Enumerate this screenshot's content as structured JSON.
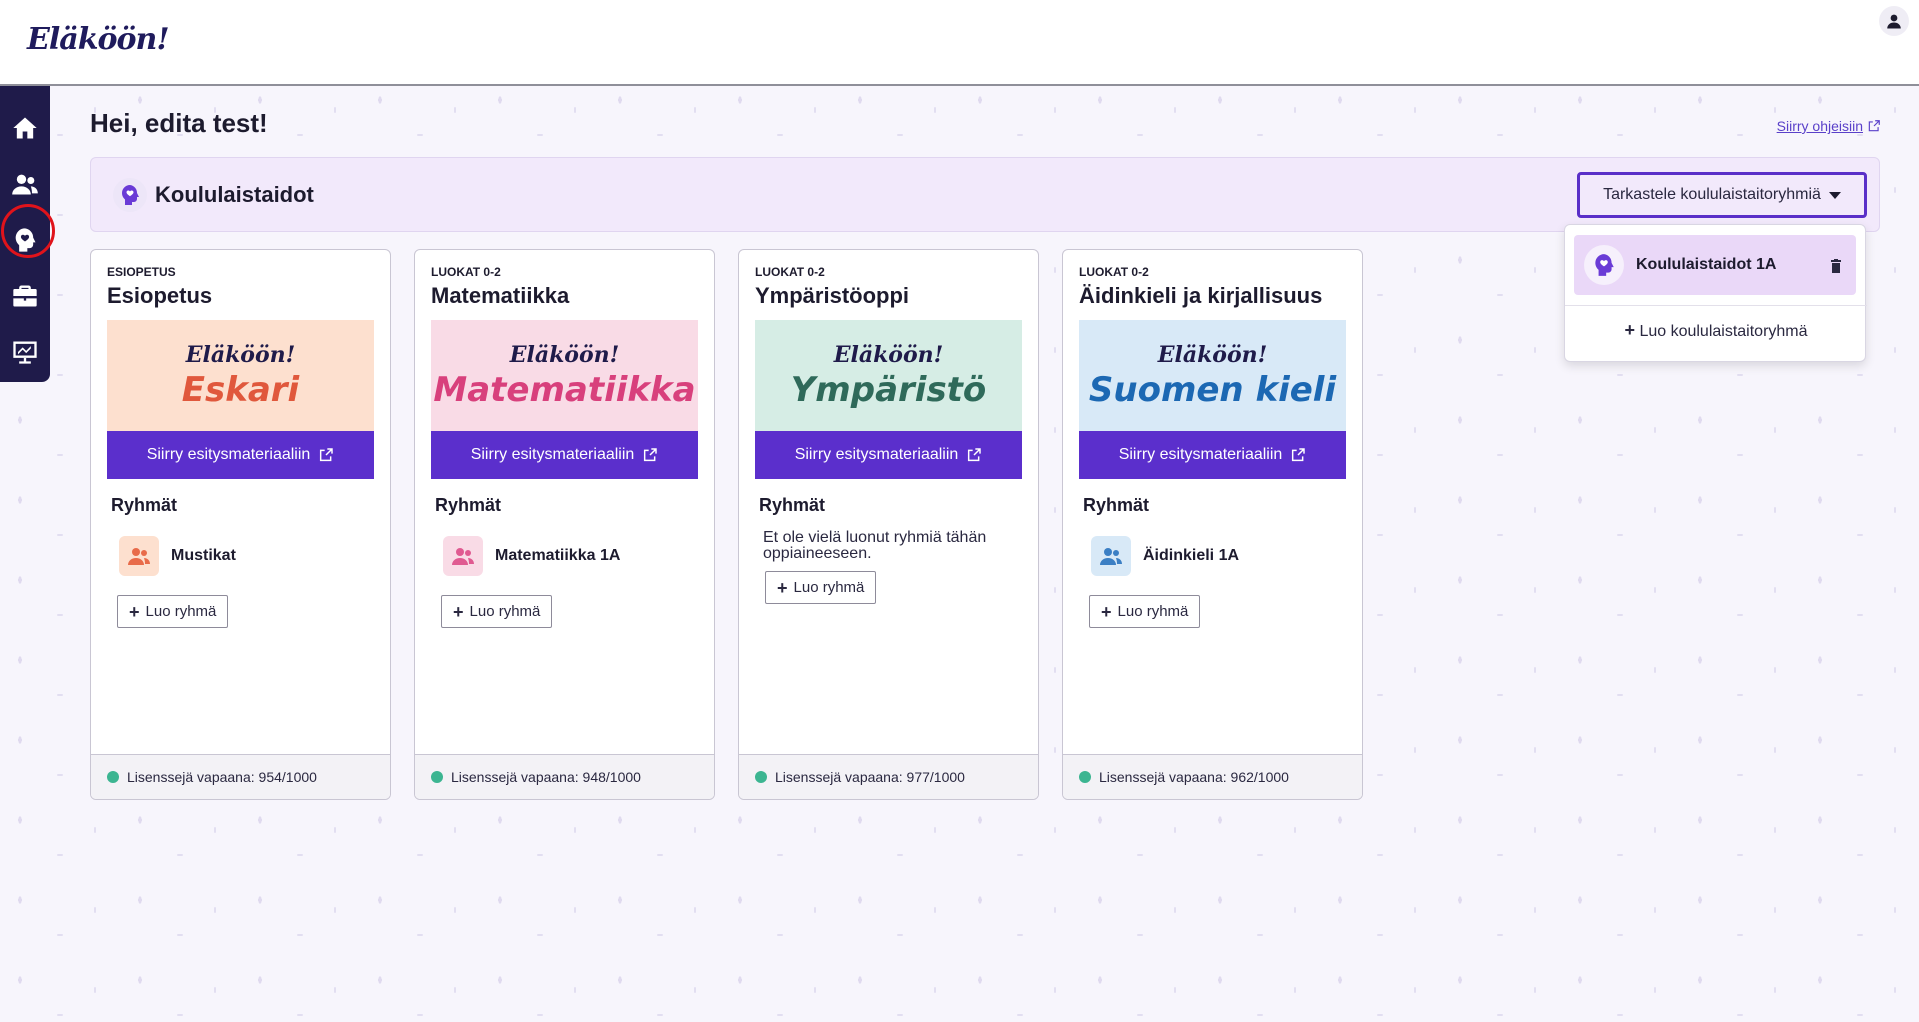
{
  "app": {
    "logo": "Eläköön!"
  },
  "header": {
    "greeting": "Hei, edita test!",
    "help_link": "Siirry ohjeisiin"
  },
  "section": {
    "title": "Koululaistaidot",
    "view_groups_button": "Tarkastele koululaistaitoryhmiä",
    "dropdown": {
      "items": [
        {
          "label": "Koululaistaidot 1A"
        }
      ],
      "create_label": "Luo koululaistaitoryhmä"
    }
  },
  "cards": [
    {
      "eyebrow": "ESIOPETUS",
      "title": "Esiopetus",
      "banner_brand": "Eläköön!",
      "banner_name": "Eskari",
      "cta": "Siirry esitysmateriaaliin",
      "groups_heading": "Ryhmät",
      "groups": [
        {
          "name": "Mustikat"
        }
      ],
      "empty_text": "",
      "create_group": "Luo ryhmä",
      "license": "Lisenssejä vapaana: 954/1000",
      "colors": {
        "banner_bg": "#fde0cf",
        "banner_text": "#e0583c",
        "avatar_bg": "#fde0cf",
        "avatar_icon": "#e86b4a"
      }
    },
    {
      "eyebrow": "LUOKAT 0-2",
      "title": "Matematiikka",
      "banner_brand": "Eläköön!",
      "banner_name": "Matematiikka",
      "cta": "Siirry esitysmateriaaliin",
      "groups_heading": "Ryhmät",
      "groups": [
        {
          "name": "Matematiikka 1A"
        }
      ],
      "empty_text": "",
      "create_group": "Luo ryhmä",
      "license": "Lisenssejä vapaana: 948/1000",
      "colors": {
        "banner_bg": "#f9dbe6",
        "banner_text": "#d8407c",
        "avatar_bg": "#f9dbe6",
        "avatar_icon": "#e05a91"
      }
    },
    {
      "eyebrow": "LUOKAT 0-2",
      "title": "Ympäristöoppi",
      "banner_brand": "Eläköön!",
      "banner_name": "Ympäristö",
      "cta": "Siirry esitysmateriaaliin",
      "groups_heading": "Ryhmät",
      "groups": [],
      "empty_text": "Et ole vielä luonut ryhmiä tähän oppiaineeseen.",
      "create_group": "Luo ryhmä",
      "license": "Lisenssejä vapaana: 977/1000",
      "colors": {
        "banner_bg": "#d6ede5",
        "banner_text": "#2f6a5a",
        "avatar_bg": "#d6ede5",
        "avatar_icon": "#2f6a5a"
      }
    },
    {
      "eyebrow": "LUOKAT 0-2",
      "title": "Äidinkieli ja kirjallisuus",
      "banner_brand": "Eläköön!",
      "banner_name": "Suomen kieli",
      "cta": "Siirry esitysmateriaaliin",
      "groups_heading": "Ryhmät",
      "groups": [
        {
          "name": "Äidinkieli 1A"
        }
      ],
      "empty_text": "",
      "create_group": "Luo ryhmä",
      "license": "Lisenssejä vapaana: 962/1000",
      "colors": {
        "banner_bg": "#d8e9f7",
        "banner_text": "#1c68b3",
        "avatar_bg": "#d8e9f7",
        "avatar_icon": "#3b7fc4"
      }
    }
  ],
  "colors": {
    "accent": "#5b2fcc",
    "nav_bg": "#1f1b4a",
    "section_bg": "#f2e9fb",
    "license_dot": "#3cb591"
  },
  "icons": [
    "home-icon",
    "users-icon",
    "school-skills-icon",
    "briefcase-icon",
    "presentation-icon",
    "user-icon",
    "external-link-icon",
    "trash-icon",
    "plus-icon"
  ]
}
